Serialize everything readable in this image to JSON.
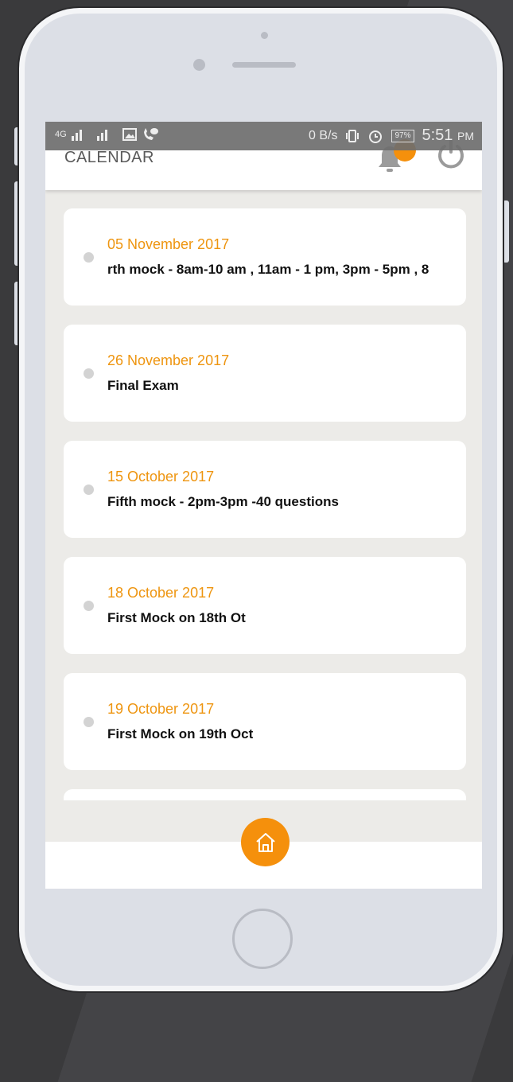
{
  "app": {
    "title": "CALENDAR"
  },
  "status_bar": {
    "network": "4G",
    "speed": "0 B/s",
    "battery": "97%",
    "time": "5:51",
    "ampm": "PM"
  },
  "events": [
    {
      "date": "05 November 2017",
      "description": "rth mock  - 8am-10 am , 11am - 1 pm, 3pm - 5pm , 8"
    },
    {
      "date": "26 November 2017",
      "description": "Final Exam"
    },
    {
      "date": "15 October 2017",
      "description": " Fifth mock  - 2pm-3pm -40 questions"
    },
    {
      "date": "18 October 2017",
      "description": "First Mock on 18th Ot"
    },
    {
      "date": "19 October 2017",
      "description": "First Mock on 19th Oct"
    }
  ],
  "colors": {
    "accent": "#f5900c",
    "date_text": "#ee9510",
    "background": "#ecebe8"
  },
  "icons": {
    "notifications": "bell-icon",
    "logout": "power-icon",
    "home": "home-icon"
  }
}
